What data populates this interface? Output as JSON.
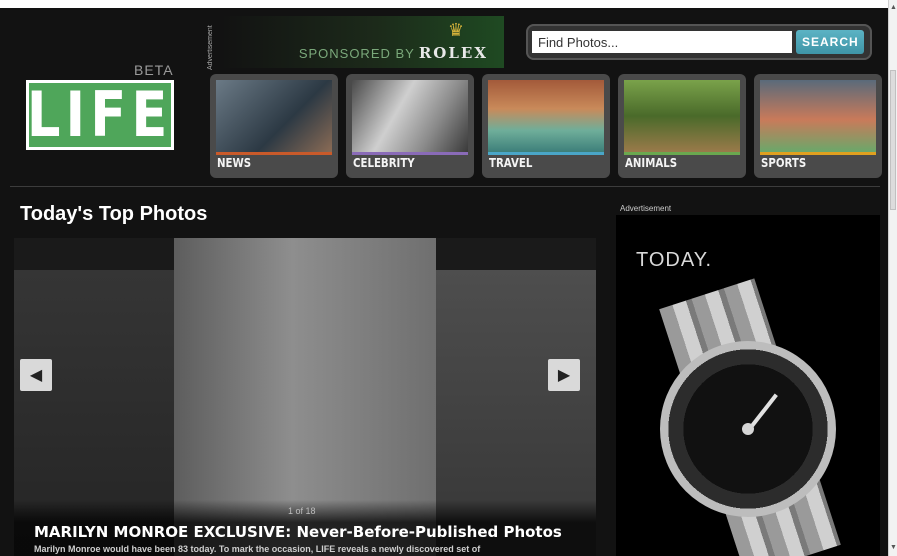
{
  "header": {
    "beta": "BETA",
    "logo": "LIFE",
    "ad_label": "Advertisement",
    "sponsor": {
      "text": "SPONSORED BY",
      "brand": "ROLEX"
    },
    "search": {
      "placeholder": "Find Photos...",
      "button": "SEARCH"
    }
  },
  "nav": {
    "items": [
      {
        "label": "NEWS",
        "accent": "#c95a2a"
      },
      {
        "label": "CELEBRITY",
        "accent": "#8a6bb8"
      },
      {
        "label": "TRAVEL",
        "accent": "#4aa6c8"
      },
      {
        "label": "ANIMALS",
        "accent": "#6aa84f"
      },
      {
        "label": "SPORTS",
        "accent": "#e0a020"
      }
    ]
  },
  "main": {
    "title": "Today's Top Photos",
    "carousel": {
      "counter": "1 of 18",
      "headline": "MARILYN MONROE EXCLUSIVE: Never-Before-Published Photos",
      "summary": "Marilyn Monroe would have been 83 today. To mark the occasion, LIFE reveals a newly discovered set of"
    }
  },
  "sidebar": {
    "ad_label": "Advertisement",
    "ad_headline": "TODAY."
  },
  "colors": {
    "brand_green": "#4fa65a",
    "search_blue": "#4aa6b8",
    "background": "#121212"
  },
  "icons": {
    "prev": "chevron-left-icon",
    "next": "chevron-right-icon",
    "crown": "crown-icon"
  }
}
